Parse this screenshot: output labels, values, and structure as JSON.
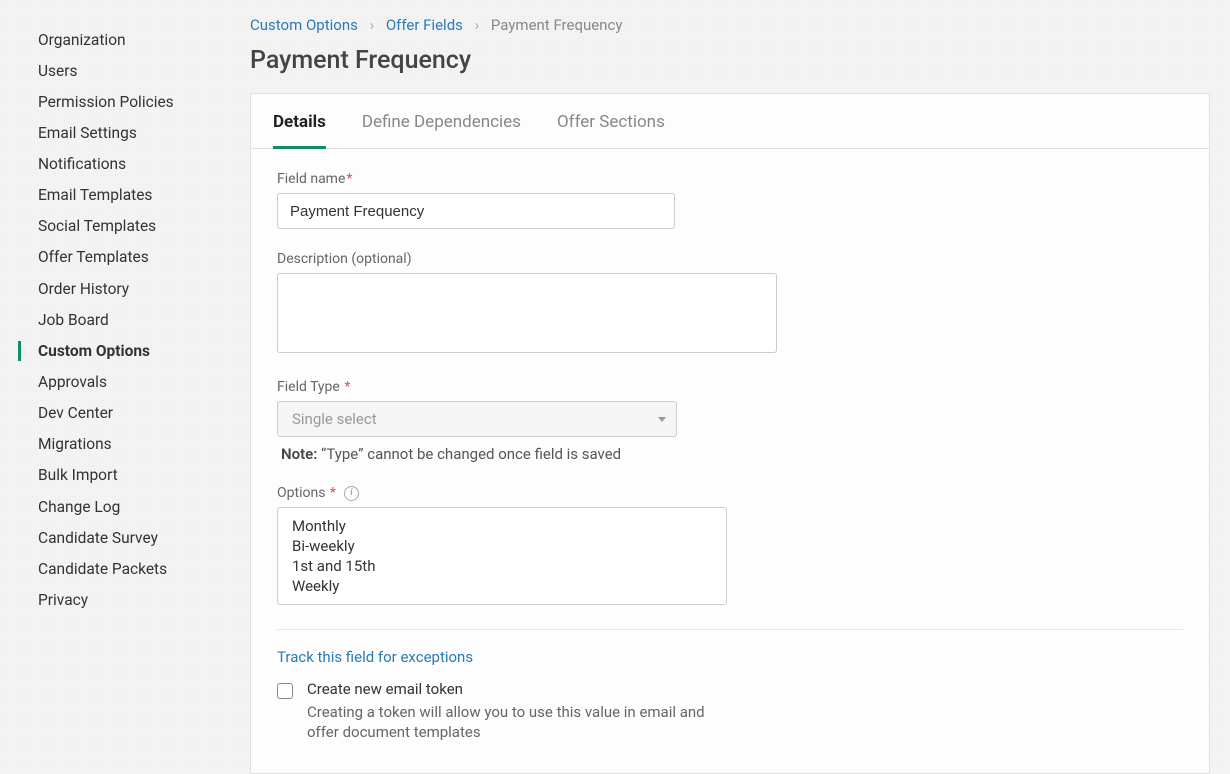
{
  "sidebar": {
    "items": [
      {
        "label": "Organization",
        "active": false
      },
      {
        "label": "Users",
        "active": false
      },
      {
        "label": "Permission Policies",
        "active": false
      },
      {
        "label": "Email Settings",
        "active": false
      },
      {
        "label": "Notifications",
        "active": false
      },
      {
        "label": "Email Templates",
        "active": false
      },
      {
        "label": "Social Templates",
        "active": false
      },
      {
        "label": "Offer Templates",
        "active": false
      },
      {
        "label": "Order History",
        "active": false
      },
      {
        "label": "Job Board",
        "active": false
      },
      {
        "label": "Custom Options",
        "active": true
      },
      {
        "label": "Approvals",
        "active": false
      },
      {
        "label": "Dev Center",
        "active": false
      },
      {
        "label": "Migrations",
        "active": false
      },
      {
        "label": "Bulk Import",
        "active": false
      },
      {
        "label": "Change Log",
        "active": false
      },
      {
        "label": "Candidate Survey",
        "active": false
      },
      {
        "label": "Candidate Packets",
        "active": false
      },
      {
        "label": "Privacy",
        "active": false
      }
    ]
  },
  "breadcrumbs": {
    "a": "Custom Options",
    "b": "Offer Fields",
    "current": "Payment Frequency"
  },
  "page_title": "Payment Frequency",
  "tabs": [
    {
      "label": "Details",
      "active": true
    },
    {
      "label": "Define Dependencies",
      "active": false
    },
    {
      "label": "Offer Sections",
      "active": false
    }
  ],
  "form": {
    "field_name_label": "Field name",
    "field_name_value": "Payment Frequency",
    "description_label": "Description (optional)",
    "description_value": "",
    "field_type_label": "Field Type",
    "field_type_value": "Single select",
    "note_prefix": "Note:",
    "note_text": "“Type” cannot be changed once field is saved",
    "options_label": "Options",
    "options": [
      "Monthly",
      "Bi-weekly",
      "1st and 15th",
      "Weekly"
    ],
    "track_link": "Track this field for exceptions",
    "token_checkbox_label": "Create new email token",
    "token_checkbox_desc": "Creating a token will allow you to use this value in email and offer document templates"
  }
}
